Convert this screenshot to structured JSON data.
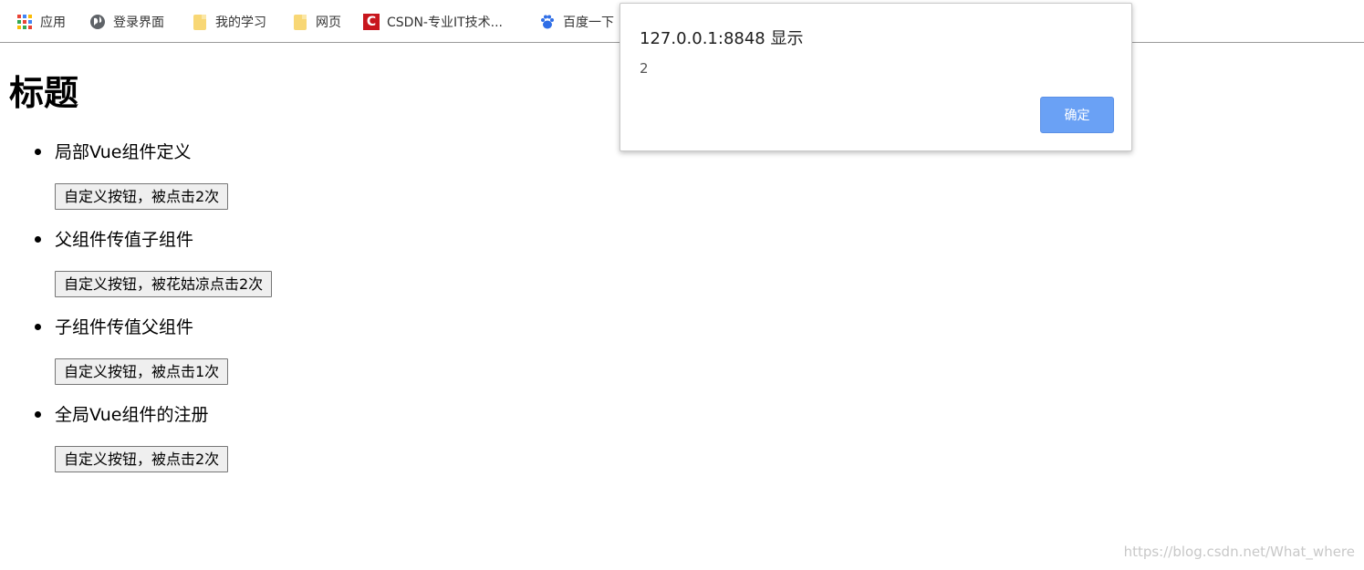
{
  "bookmarks": [
    {
      "label": "应用",
      "icon": "apps-grid-icon"
    },
    {
      "label": "登录界面",
      "icon": "globe-icon"
    },
    {
      "label": "我的学习",
      "icon": "folder-icon"
    },
    {
      "label": "网页",
      "icon": "folder-icon"
    },
    {
      "label": "CSDN-专业IT技术...",
      "icon": "csdn-logo-icon"
    },
    {
      "label": "百度一下",
      "icon": "baidu-paw-icon"
    }
  ],
  "page": {
    "title": "标题",
    "items": [
      {
        "label": "局部Vue组件定义",
        "button": "自定义按钮，被点击2次"
      },
      {
        "label": "父组件传值子组件",
        "button": "自定义按钮，被花姑凉点击2次"
      },
      {
        "label": "子组件传值父组件",
        "button": "自定义按钮，被点击1次"
      },
      {
        "label": "全局Vue组件的注册",
        "button": "自定义按钮，被点击2次"
      }
    ]
  },
  "dialog": {
    "title": "127.0.0.1:8848 显示",
    "message": "2",
    "ok_label": "确定"
  },
  "watermark": "https://blog.csdn.net/What_where",
  "colors": {
    "dialog_button": "#6aa1f5",
    "csdn_red": "#c8161d",
    "folder_yellow": "#f8d775",
    "baidu_blue": "#2f6ee6"
  }
}
